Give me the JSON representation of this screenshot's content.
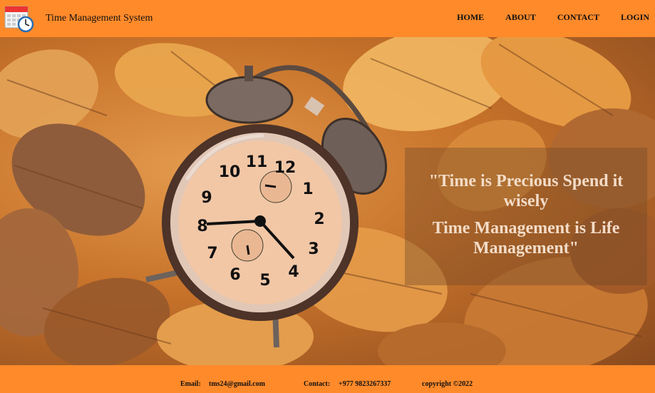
{
  "header": {
    "title": "Time Management System",
    "logo_icon": "calendar-clock-icon",
    "nav": [
      {
        "label": "HOME"
      },
      {
        "label": "ABOUT"
      },
      {
        "label": "CONTACT"
      },
      {
        "label": "LOGIN"
      }
    ]
  },
  "hero": {
    "background_icon": "alarm-clock-on-autumn-leaves",
    "clock_numbers": [
      "12",
      "1",
      "2",
      "3",
      "4",
      "5",
      "6",
      "7",
      "8",
      "9",
      "10",
      "11"
    ],
    "quote_line1": "\"Time is Precious Spend it wisely",
    "quote_line2": "Time Management is Life Management\""
  },
  "footer": {
    "email_label": "Email:",
    "email": "tms24@gmail.com",
    "contact_label": "Contact:",
    "contact": "+977 9823267337",
    "copyright": "copyright ©2022"
  },
  "colors": {
    "bar": "#ff8a2a",
    "quote_text": "#f3dcc8"
  }
}
